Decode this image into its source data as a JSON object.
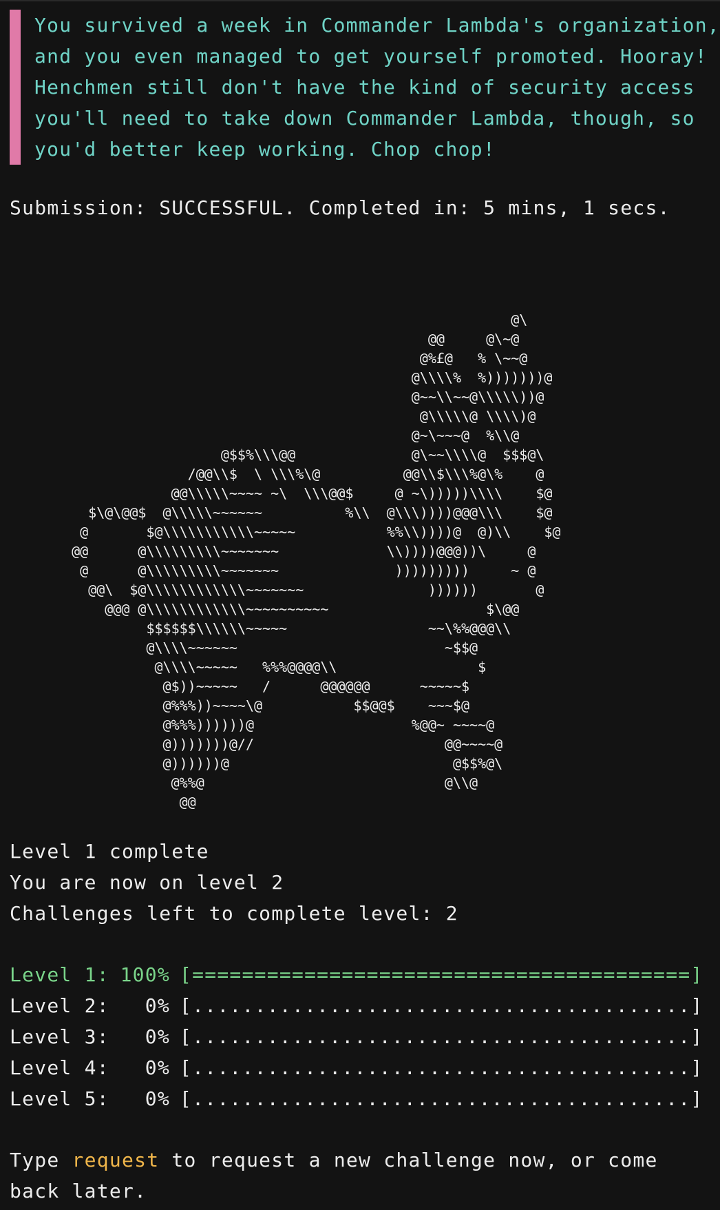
{
  "message": {
    "lines": [
      "You survived a week in Commander Lambda's organization,",
      "and you even managed to get yourself promoted. Hooray!",
      "Henchmen still don't have the kind of security access",
      "you'll need to take down Commander Lambda, though, so",
      "you'd better keep working. Chop chop!"
    ],
    "accent_color": "#e07aa8",
    "text_color": "#6fd3c6"
  },
  "submission": "Submission: SUCCESSFUL. Completed in: 5 mins, 1 secs.",
  "ascii_art": "                                                       @\\\n                                             @@     @\\~@\n                                            @%£@   % \\~~@\n                                           @\\\\\\\\%  %)))))))@\n                                           @~~\\\\~~@\\\\\\\\\\))@\n                                            @\\\\\\\\\\@ \\\\\\\\)@\n                                           @~\\~~~@  %\\\\@\n                    @$$%\\\\\\@@              @\\~~\\\\\\\\@  $$$@\\\n                /@@\\\\$  \\ \\\\\\%\\@          @@\\\\$\\\\\\%@\\%    @\n              @@\\\\\\\\\\~~~~ ~\\  \\\\\\@@$     @ ~\\)))))\\\\\\\\    $@\n    $\\@\\@@$  @\\\\\\\\\\~~~~~~          %\\\\  @\\\\\\))))@@@\\\\\\    $@\n   @       $@\\\\\\\\\\\\\\\\\\\\\\~~~~~           %%\\\\))))@  @)\\\\    $@\n  @@      @\\\\\\\\\\\\\\\\\\~~~~~~~             \\\\))))@@@))\\     @\n   @      @\\\\\\\\\\\\\\\\\\~~~~~~~              )))))))))     ~ @\n    @@\\  $@\\\\\\\\\\\\\\\\\\\\\\\\~~~~~~~               ))))))       @\n      @@@ @\\\\\\\\\\\\\\\\\\\\\\\\~~~~~~~~~~                   $\\@@\n           $$$$$$\\\\\\\\\\\\~~~~~                 ~~\\%%@@@\\\\\n           @\\\\\\\\~~~~~~                         ~$$@\n            @\\\\\\\\~~~~~   %%%@@@@\\\\                 $\n             @$))~~~~~   /      @@@@@@      ~~~~~$\n             @%%%))~~~~\\@           $$@@$    ~~~$@\n             @%%%))))))@                   %@@~ ~~~~@\n             @)))))))@//                       @@~~~~@\n             @))))))@                           @$$%@\\\n              @%%@                             @\\\\@\n               @@",
  "status": [
    "Level 1 complete",
    "You are now on level 2",
    "Challenges left to complete level: 2"
  ],
  "levels": [
    {
      "name": "Level 1:",
      "pct": "100%",
      "bar": "[========================================]",
      "complete": true
    },
    {
      "name": "Level 2:",
      "pct": "0%",
      "bar": "[........................................]",
      "complete": false
    },
    {
      "name": "Level 3:",
      "pct": "0%",
      "bar": "[........................................]",
      "complete": false
    },
    {
      "name": "Level 4:",
      "pct": "0%",
      "bar": "[........................................]",
      "complete": false
    },
    {
      "name": "Level 5:",
      "pct": "0%",
      "bar": "[........................................]",
      "complete": false
    }
  ],
  "prompt": {
    "before": "Type ",
    "command": "request",
    "after": " to request a new challenge now, or come back later.",
    "command_color": "#efb54a"
  },
  "colors": {
    "background": "#131313",
    "text": "#ececec",
    "complete": "#7ad48a"
  }
}
